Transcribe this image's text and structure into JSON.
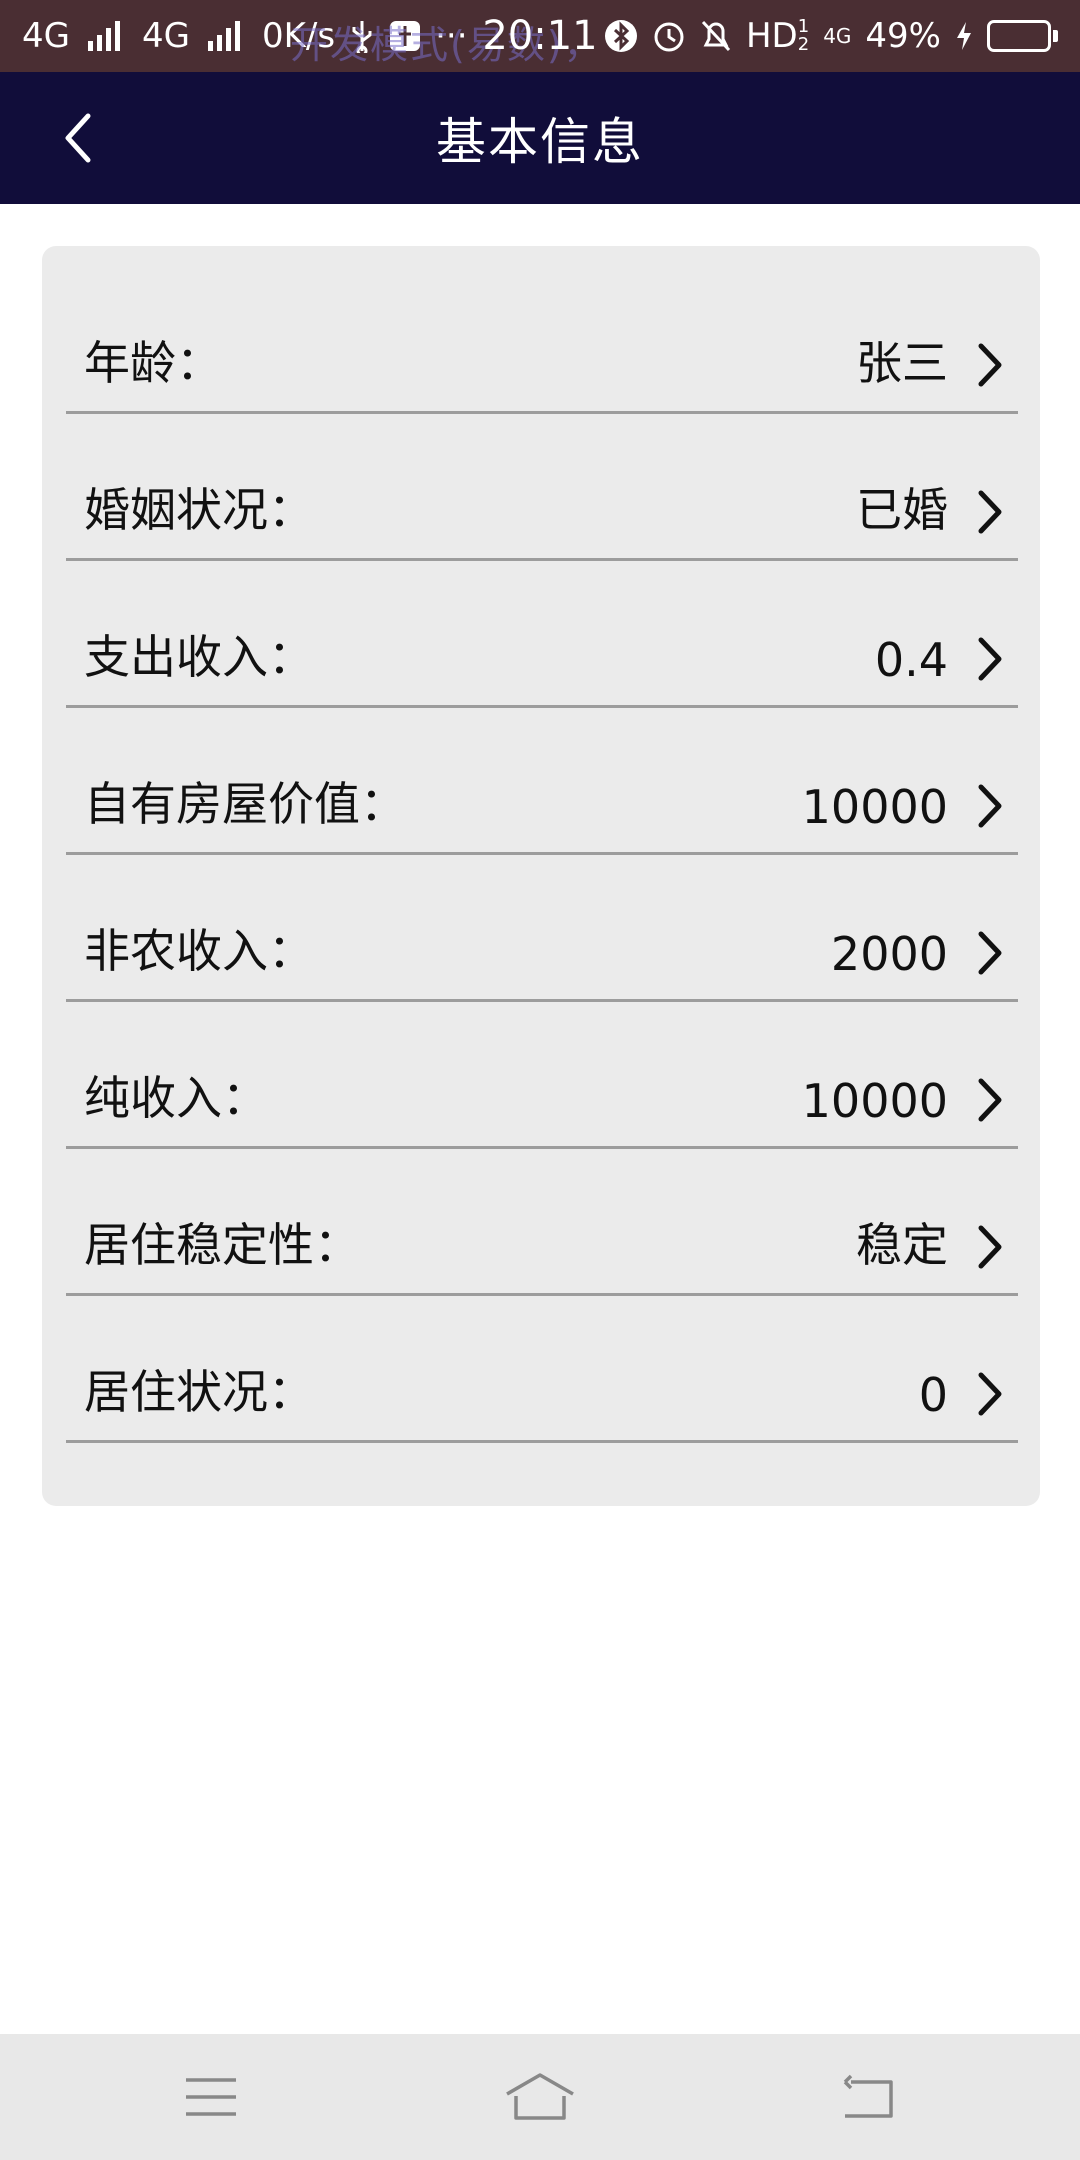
{
  "status_bar": {
    "network_1": "4G",
    "network_2": "4G",
    "speed": "0K/s",
    "ghost_text": "开发模式(易数)，",
    "time": "20:11",
    "hd": "HD",
    "hd_sup": "1",
    "hd_sub": "2",
    "network_small": "4G",
    "battery": "49%",
    "battery_level": 0.49
  },
  "header": {
    "title": "基本信息"
  },
  "rows": [
    {
      "label": "年龄：",
      "value": "张三"
    },
    {
      "label": "婚姻状况：",
      "value": "已婚"
    },
    {
      "label": "支出收入：",
      "value": "0.4"
    },
    {
      "label": "自有房屋价值：",
      "value": "10000"
    },
    {
      "label": "非农收入：",
      "value": "2000"
    },
    {
      "label": "纯收入：",
      "value": "10000"
    },
    {
      "label": "居住稳定性：",
      "value": "稳定"
    },
    {
      "label": "居住状况：",
      "value": "0"
    }
  ],
  "icons": {
    "back": "chevron-left-icon",
    "row_arrow": "chevron-right-icon",
    "nav_menu": "menu-icon",
    "nav_home": "home-icon",
    "nav_back": "return-icon"
  },
  "colors": {
    "status_bar": "#4a2e33",
    "title_bar": "#110d3a",
    "card": "#ebebeb",
    "divider": "#9c9c9c",
    "nav_bar": "#e8e8e8"
  }
}
